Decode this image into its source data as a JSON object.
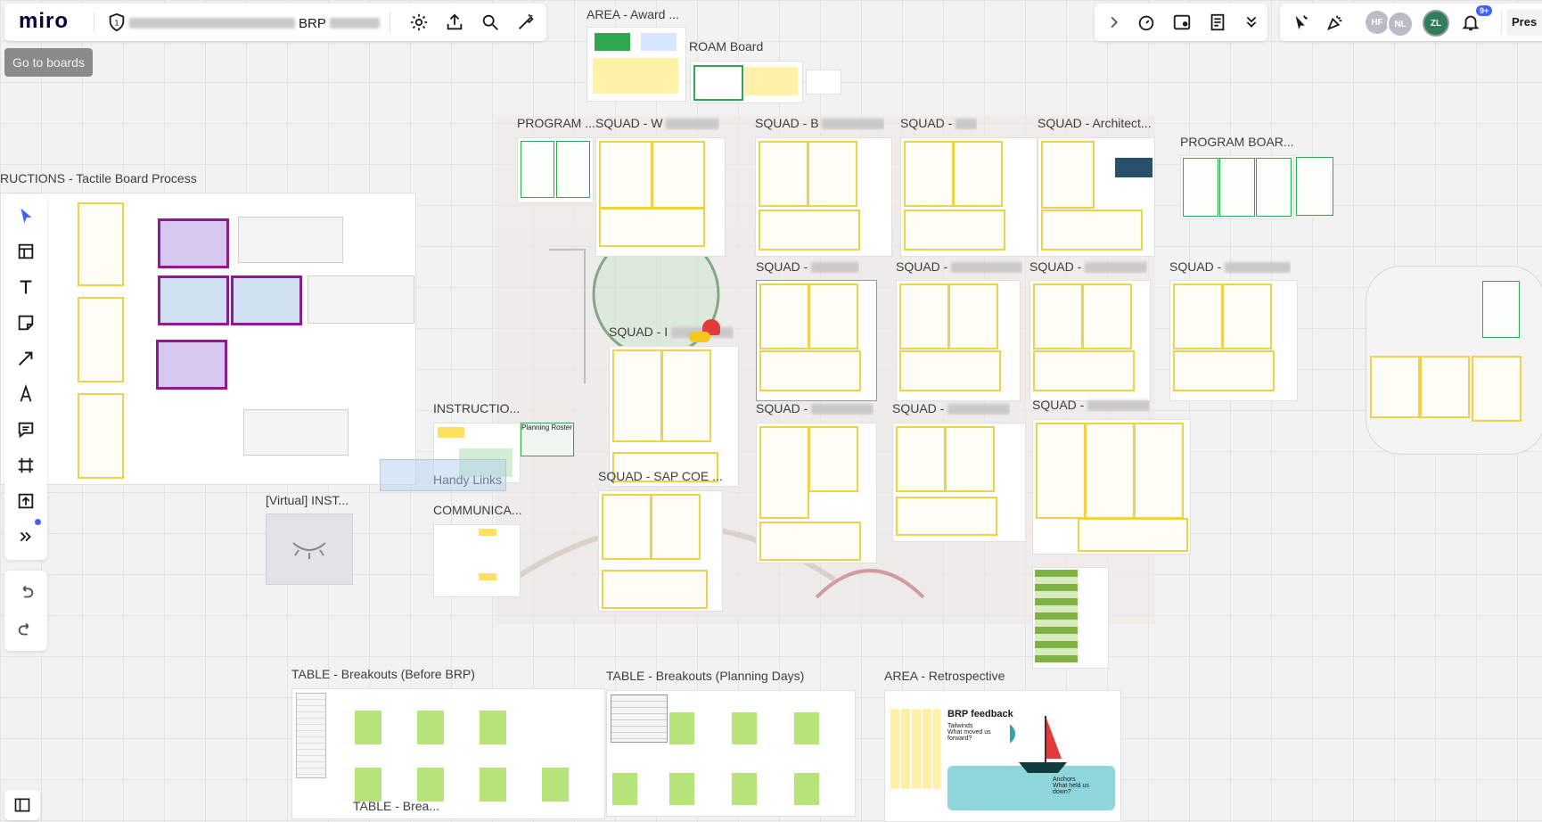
{
  "app": {
    "logo": "miro",
    "board_name_visible": "BRP",
    "go_to_boards_tooltip": "Go to boards",
    "present_label": "Pres"
  },
  "colors": {
    "accent": "#4262ff",
    "frame_yellow": "#f0d24a",
    "sticky_yellow": "#fff2a8",
    "sticky_green": "#b8e27a",
    "notification_badge": "#4262ff"
  },
  "top_toolbar": {
    "icons": [
      "shield-icon",
      "gear-icon",
      "upload-icon",
      "search-icon",
      "magic-pen-icon"
    ]
  },
  "right_toolbar": {
    "icons": [
      "chevron-right-icon",
      "timer-icon",
      "voting-icon",
      "notes-icon",
      "chevron-double-down-icon"
    ]
  },
  "collab": {
    "avatars": [
      {
        "initials": "HF",
        "color": "#b9bcc6"
      },
      {
        "initials": "NL",
        "color": "#b9bcc6"
      },
      {
        "initials": "ZL",
        "color": "#2e7d5b"
      }
    ],
    "notification_count": "9+"
  },
  "left_toolbar": {
    "tools": [
      "cursor-icon",
      "templates-icon",
      "text-icon",
      "sticky-note-icon",
      "arrow-icon",
      "pen-icon",
      "comment-icon",
      "frame-icon",
      "upload-icon",
      "more-tools-icon"
    ],
    "undo": "undo-icon",
    "redo": "redo-icon"
  },
  "frames": {
    "award": "AREA - Award ...",
    "roam": "ROAM Board",
    "instructions_tactile": "RUCTIONS - Tactile Board Process",
    "program1": "PROGRAM ...",
    "squad_w": "SQUAD - W",
    "squad_b": "SQUAD - B",
    "squad_3": "SQUAD -",
    "squad_arch": "SQUAD - Architect...",
    "program_board": "PROGRAM BOAR...",
    "squad_r2_1": "SQUAD -",
    "squad_r2_2": "SQUAD -",
    "squad_r2_3": "SQUAD -",
    "squad_r2_4": "SQUAD -",
    "squad_i": "SQUAD - I",
    "squad_r3_1": "SQUAD -",
    "squad_r3_2": "SQUAD -",
    "squad_r3_3": "SQUAD -",
    "squad_sap": "SQUAD - SAP COE ...",
    "instructions2": "INSTRUCTIO...",
    "planning_roster": "Planning Roster",
    "handy_links": "Handy Links",
    "communica": "COMMUNICA...",
    "virtual_inst": "[Virtual] INST...",
    "table_before": "TABLE - Breakouts (Before BRP)",
    "table_planning": "TABLE - Breakouts (Planning Days)",
    "table_brea": "TABLE - Brea...",
    "retro": "AREA - Retrospective",
    "retro_title": "BRP feedback",
    "retro_tailwinds": "Tailwinds\nWhat moved us forward?",
    "retro_anchors": "Anchors\nWhat held us down?"
  }
}
